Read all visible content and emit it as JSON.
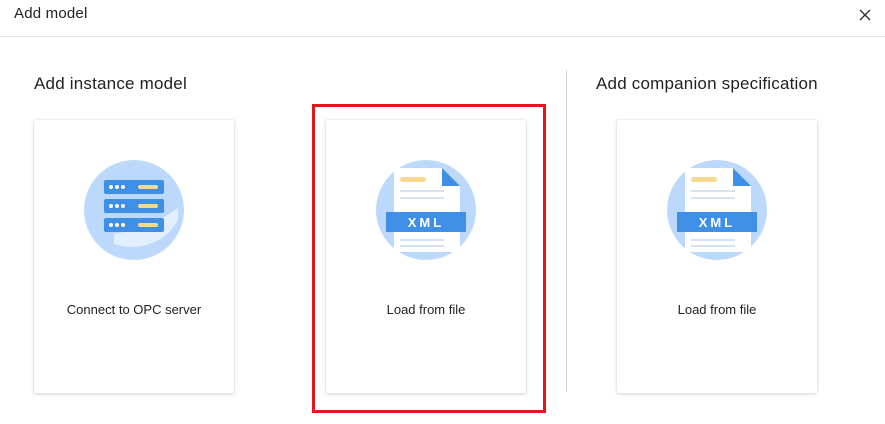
{
  "dialog": {
    "title": "Add model",
    "close_icon": "close-icon"
  },
  "sections": {
    "instance": {
      "title": "Add instance model",
      "cards": [
        {
          "label": "Connect to OPC server",
          "icon": "server-icon"
        },
        {
          "label": "Load from file",
          "icon": "xml-file-icon",
          "icon_text": "XML"
        }
      ]
    },
    "companion": {
      "title": "Add companion specification",
      "cards": [
        {
          "label": "Load from file",
          "icon": "xml-file-icon",
          "icon_text": "XML"
        }
      ]
    }
  },
  "colors": {
    "icon_circle": "#bcd9fb",
    "icon_blue": "#3f8fe6",
    "highlight_border": "#e3161e",
    "file_accent": "#f9d890"
  }
}
